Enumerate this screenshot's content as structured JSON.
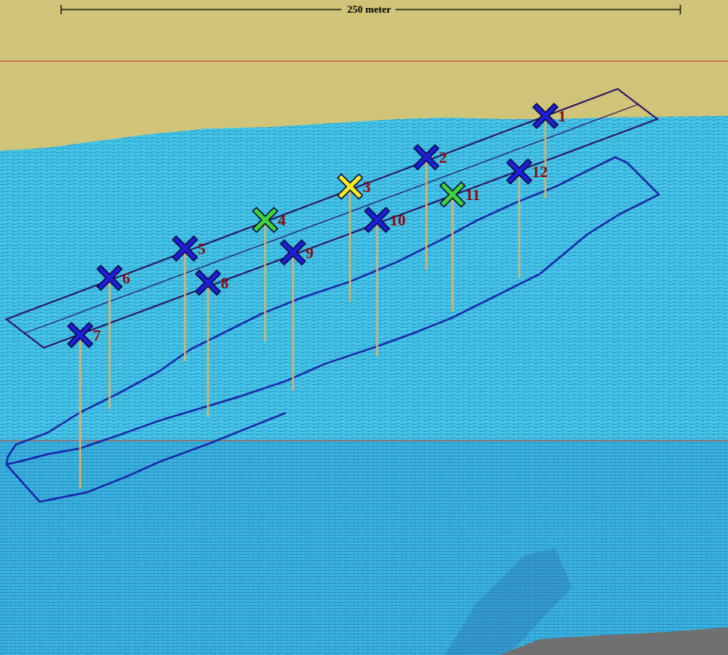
{
  "scale_bar": {
    "label": "250 meter"
  },
  "colors": {
    "land": "#cfc478",
    "sea": "#3fc3e2",
    "sea_texture": "#1f86c8",
    "horizon_line": "#c0392b",
    "outline": "#2a1460",
    "stem": "#d9b36a",
    "label": "#8b0a0a"
  },
  "markers": [
    {
      "id": "1",
      "label": "1",
      "color": "#1c1fd6"
    },
    {
      "id": "2",
      "label": "2",
      "color": "#1c1fd6"
    },
    {
      "id": "3",
      "label": "3",
      "color": "#f2ec22"
    },
    {
      "id": "4",
      "label": "4",
      "color": "#3ed43a"
    },
    {
      "id": "5",
      "label": "5",
      "color": "#1c1fd6"
    },
    {
      "id": "6",
      "label": "6",
      "color": "#1c1fd6"
    },
    {
      "id": "7",
      "label": "7",
      "color": "#1c1fd6"
    },
    {
      "id": "8",
      "label": "8",
      "color": "#1c1fd6"
    },
    {
      "id": "9",
      "label": "9",
      "color": "#1c1fd6"
    },
    {
      "id": "10",
      "label": "10",
      "color": "#1c1fd6"
    },
    {
      "id": "11",
      "label": "11",
      "color": "#3ed43a"
    },
    {
      "id": "12",
      "label": "12",
      "color": "#1c1fd6"
    }
  ]
}
